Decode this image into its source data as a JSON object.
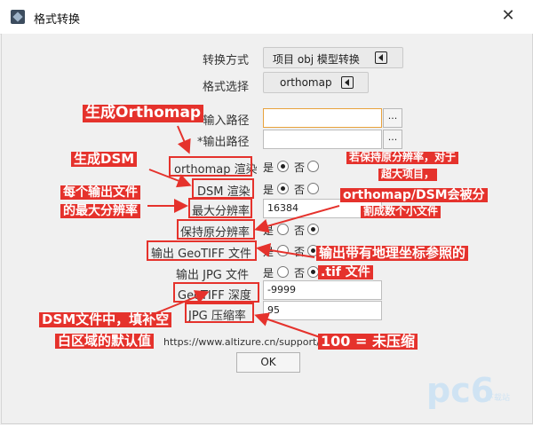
{
  "window": {
    "title": "格式转换",
    "close_glyph": "✕"
  },
  "form": {
    "conversion_mode": {
      "label": "转换方式",
      "value": "项目 obj 模型转换"
    },
    "format_select": {
      "label": "格式选择",
      "value": "orthomap"
    },
    "input_path": {
      "label": "输入路径",
      "required_mark": "*",
      "value": "",
      "browse": "..."
    },
    "output_path": {
      "label": "输出路径",
      "required_mark": "*",
      "value": "",
      "browse": "..."
    },
    "orthomap_render": {
      "label": "orthomap 渲染",
      "yes": "是",
      "no": "否",
      "selected": "yes"
    },
    "dsm_render": {
      "label": "DSM 渲染",
      "yes": "是",
      "no": "否",
      "selected": "yes"
    },
    "max_resolution": {
      "label": "最大分辨率",
      "value": "16384"
    },
    "keep_resolution": {
      "label": "保持原分辨率",
      "yes": "是",
      "no": "否",
      "selected": "no"
    },
    "output_geotiff": {
      "label": "输出 GeoTIFF 文件",
      "yes": "是",
      "no": "否",
      "selected": "no"
    },
    "output_jpg": {
      "label": "输出 JPG 文件",
      "yes": "是",
      "no": "否",
      "selected": "no"
    },
    "geotiff_depth": {
      "label": "GeoTIFF 深度",
      "value": "-9999"
    },
    "jpg_quality": {
      "label": "JPG 压缩率",
      "value": "95"
    },
    "url": "https://www.altizure.cn/support/artic",
    "ok": "OK"
  },
  "annotations": {
    "orthomap": "生成Orthomap",
    "dsm": "生成DSM",
    "max_res_line1": "每个输出文件",
    "max_res_line2": "的最大分辨率",
    "keep_res_line1": "若保持原分辨率，对于",
    "keep_res_line2": "超大项目，",
    "keep_res_line3": "orthomap/DSM会被分",
    "keep_res_line4": "割成数个小文件",
    "geotiff_line1": "输出带有地理坐标参照的",
    "geotiff_line2": ".tif 文件",
    "depth_line1": "DSM文件中，填补空",
    "depth_line2": "白区域的默认值",
    "quality": "100 = 未压缩"
  },
  "colors": {
    "annotation_red": "#e5322c",
    "focus_border": "#e8a23c"
  },
  "watermark": {
    "main": "pc6",
    "sub": "下载站"
  }
}
